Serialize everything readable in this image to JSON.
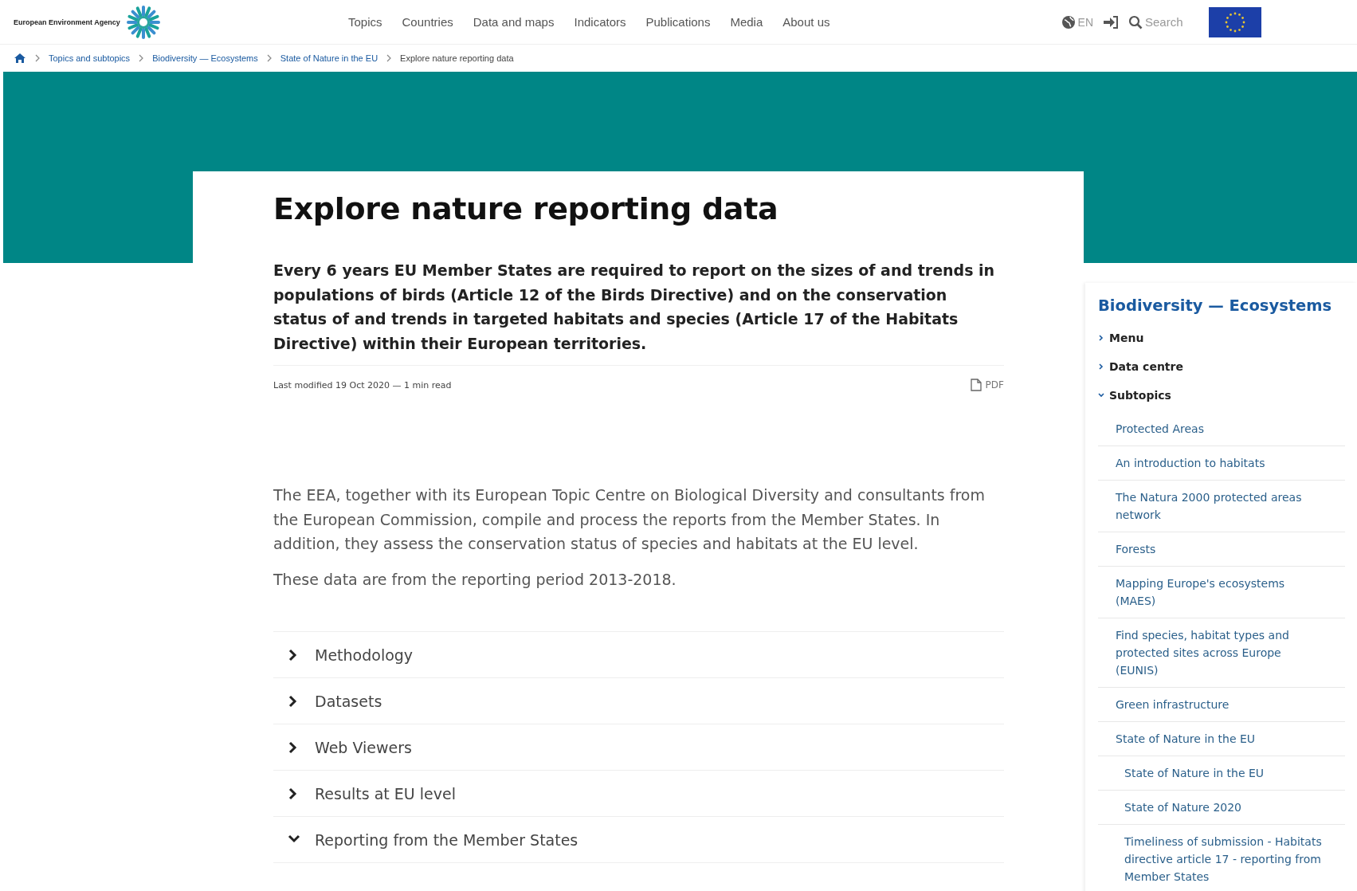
{
  "header": {
    "logo_text": "European Environment Agency",
    "nav": [
      {
        "label": "Topics"
      },
      {
        "label": "Countries"
      },
      {
        "label": "Data and maps"
      },
      {
        "label": "Indicators"
      },
      {
        "label": "Publications"
      },
      {
        "label": "Media"
      },
      {
        "label": "About us"
      }
    ],
    "language": "EN",
    "search": {
      "placeholder": "Search"
    }
  },
  "breadcrumb": [
    {
      "label": "Topics and subtopics",
      "current": false
    },
    {
      "label": "Biodiversity — Ecosystems",
      "current": false
    },
    {
      "label": "State of Nature in the EU",
      "current": false
    },
    {
      "label": "Explore nature reporting data",
      "current": true
    }
  ],
  "article": {
    "title": "Explore nature reporting data",
    "lead": "Every 6 years EU Member States are required to report on the sizes of and trends in populations of birds (Article 12 of the Birds Directive) and on the conservation status of and trends in targeted habitats and species (Article 17 of the Habitats Directive) within their European territories.",
    "meta": "Last modified 19 Oct 2020 — 1 min read",
    "pdf_link": "PDF",
    "paragraphs": [
      "The EEA, together with its European Topic Centre on Biological Diversity and consultants from the European Commission, compile and process the reports from the Member States. In addition, they assess the conservation status of species and habitats at the EU level.",
      "These data are from the reporting period 2013-2018."
    ],
    "accordion": [
      {
        "label": "Methodology",
        "expanded": false
      },
      {
        "label": "Datasets",
        "expanded": false
      },
      {
        "label": "Web Viewers",
        "expanded": false
      },
      {
        "label": "Results at EU level",
        "expanded": false
      },
      {
        "label": "Reporting from the Member States",
        "expanded": true
      }
    ]
  },
  "sidebar": {
    "title": "Biodiversity — Ecosystems",
    "items": [
      {
        "label": "Menu",
        "kind": "section",
        "expanded": false
      },
      {
        "label": "Data centre",
        "kind": "section",
        "expanded": false
      },
      {
        "label": "Subtopics",
        "kind": "section",
        "expanded": true,
        "children": [
          {
            "label": "Protected Areas",
            "kind": "link"
          },
          {
            "label": "An introduction to habitats",
            "kind": "link"
          },
          {
            "label": "The Natura 2000 protected areas network",
            "kind": "link"
          },
          {
            "label": "Forests",
            "kind": "link"
          },
          {
            "label": "Mapping Europe's ecosystems (MAES)",
            "kind": "link"
          },
          {
            "label": "Find species, habitat types and protected sites across Europe (EUNIS)",
            "kind": "link"
          },
          {
            "label": "Green infrastructure",
            "kind": "link"
          },
          {
            "label": "State of Nature in the EU",
            "kind": "link",
            "children": [
              {
                "label": "State of Nature in the EU",
                "kind": "link"
              },
              {
                "label": "State of Nature 2020",
                "kind": "link"
              },
              {
                "label": "Timeliness of submission - Habitats directive article 17 - reporting from Member States",
                "kind": "link"
              }
            ]
          }
        ]
      }
    ]
  }
}
